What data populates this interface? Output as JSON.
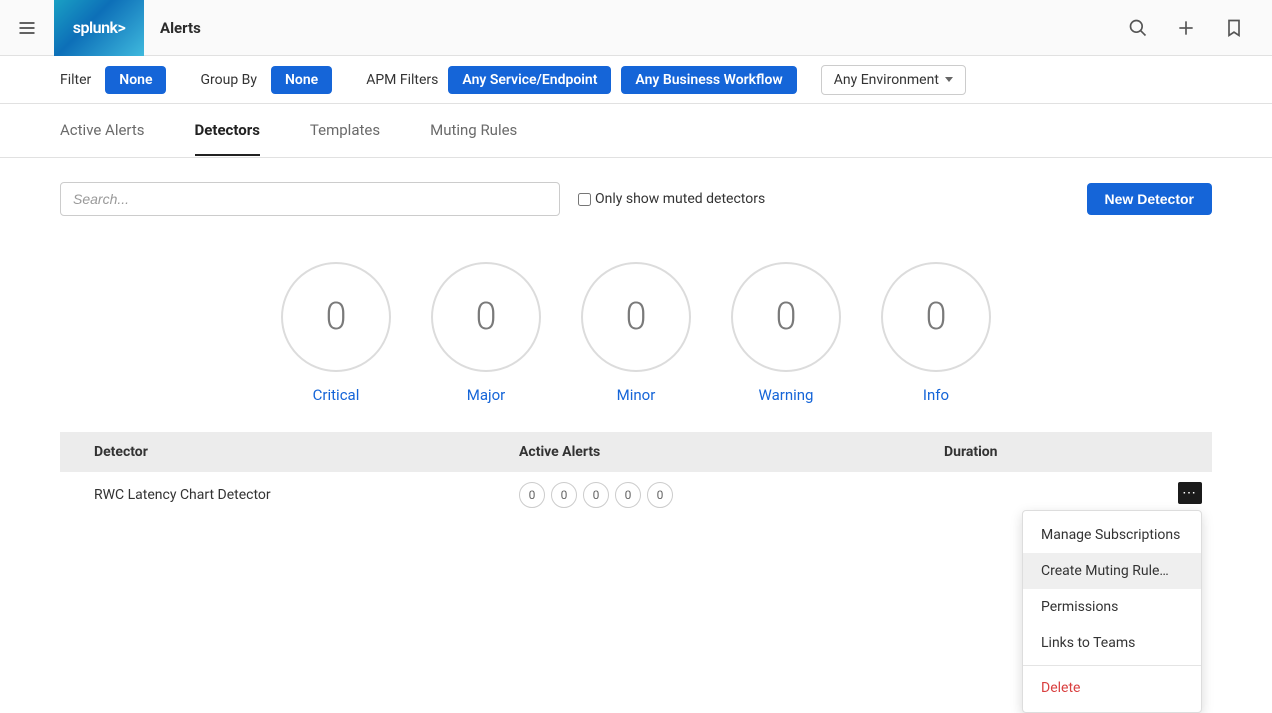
{
  "header": {
    "logo_text": "splunk>",
    "page_title": "Alerts"
  },
  "filters": {
    "filter_label": "Filter",
    "filter_value": "None",
    "group_by_label": "Group By",
    "group_by_value": "None",
    "apm_label": "APM Filters",
    "apm_service": "Any Service/Endpoint",
    "apm_workflow": "Any Business Workflow",
    "env_value": "Any Environment"
  },
  "tabs": {
    "active_alerts": "Active Alerts",
    "detectors": "Detectors",
    "templates": "Templates",
    "muting_rules": "Muting Rules"
  },
  "search": {
    "placeholder": "Search...",
    "muted_label": "Only show muted detectors",
    "new_detector_label": "New Detector"
  },
  "severities": [
    {
      "count": "0",
      "label": "Critical"
    },
    {
      "count": "0",
      "label": "Major"
    },
    {
      "count": "0",
      "label": "Minor"
    },
    {
      "count": "0",
      "label": "Warning"
    },
    {
      "count": "0",
      "label": "Info"
    }
  ],
  "table": {
    "headers": {
      "detector": "Detector",
      "active_alerts": "Active Alerts",
      "duration": "Duration"
    },
    "rows": [
      {
        "name": "RWC Latency Chart Detector",
        "counts": [
          "0",
          "0",
          "0",
          "0",
          "0"
        ],
        "duration": ""
      }
    ]
  },
  "dropdown": {
    "manage_subscriptions": "Manage Subscriptions",
    "create_muting_rule": "Create Muting Rule…",
    "permissions": "Permissions",
    "links_to_teams": "Links to Teams",
    "delete": "Delete"
  }
}
